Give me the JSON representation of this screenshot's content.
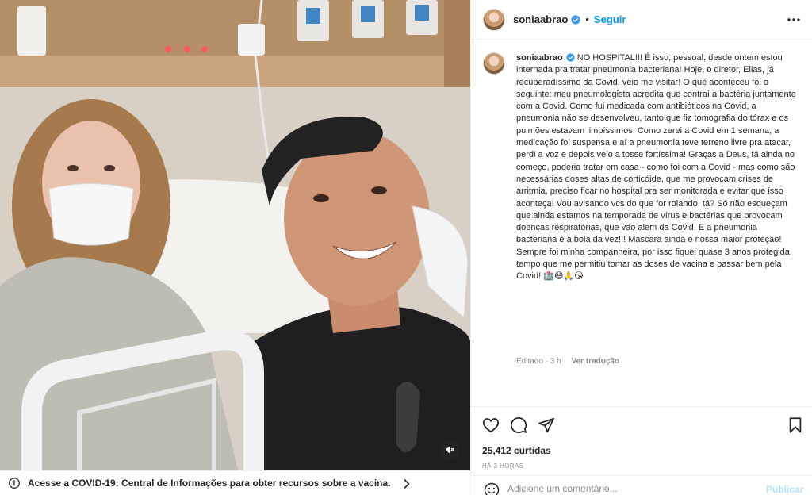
{
  "post": {
    "username": "soniaabrao",
    "follow_label": "Seguir",
    "separator": "•",
    "caption": "NO HOSPITAL!!! É isso, pessoal, desde ontem estou internada pra tratar pneumonia bacteriana! Hoje, o diretor, Elias, já recuperadíssimo da Covid, veio me visitar! O que aconteceu foi o seguinte: meu pneumologista acredita que contraí a bactéria juntamente com a Covid. Como fui medicada com antibióticos na Covid, a pneumonia não se desenvolveu, tanto que fiz tomografia do tórax e os pulmões estavam limpíssimos. Como zerei a Covid em 1 semana, a medicação foi suspensa e aí a pneumonia teve terreno livre pra atacar, perdi a voz e depois veio a tosse fortíssima! Graças a Deus, tá ainda no começo, poderia tratar em casa - como foi com a Covid - mas como são necessárias doses altas de corticóide, que me provocam crises de arritmia, preciso ficar no hospital pra ser monitorada e evitar que isso aconteça! Vou avisando vcs do que for rolando, tá? Só não esqueçam que ainda estamos na temporada de vírus e bactérias que provocam doenças respiratórias, que vão além da Covid. E a pneumonia bacteriana é a bola da vez!!! Máscara ainda é nossa maior proteção! Sempre foi minha companheira, por isso fiquei quase 3 anos protegida, tempo que me permitiu tomar as doses de vacina e passar bem pela Covid! 🏥😷🙏😘",
    "meta_edited": "Editado · 3 h",
    "translate_label": "Ver tradução",
    "likes_text": "25,412 curtidas",
    "timestamp": "HÁ 3 HORAS"
  },
  "comment": {
    "placeholder": "Adicione um comentário...",
    "publish_label": "Publicar"
  },
  "banner": {
    "text": "Acesse a COVID-19: Central de Informações para obter recursos sobre a vacina."
  },
  "icons": {
    "verified": "verified-badge-icon",
    "more": "more-options-icon",
    "like": "heart-icon",
    "comment": "comment-icon",
    "share": "share-icon",
    "save": "bookmark-icon",
    "emoji": "emoji-icon",
    "mute": "mute-icon",
    "info": "info-icon",
    "chevron": "chevron-right-icon"
  },
  "colors": {
    "accent": "#0095f6",
    "verified": "#3897f0",
    "publish_disabled": "#b2dffc",
    "secondary_text": "#8e8e8e"
  }
}
